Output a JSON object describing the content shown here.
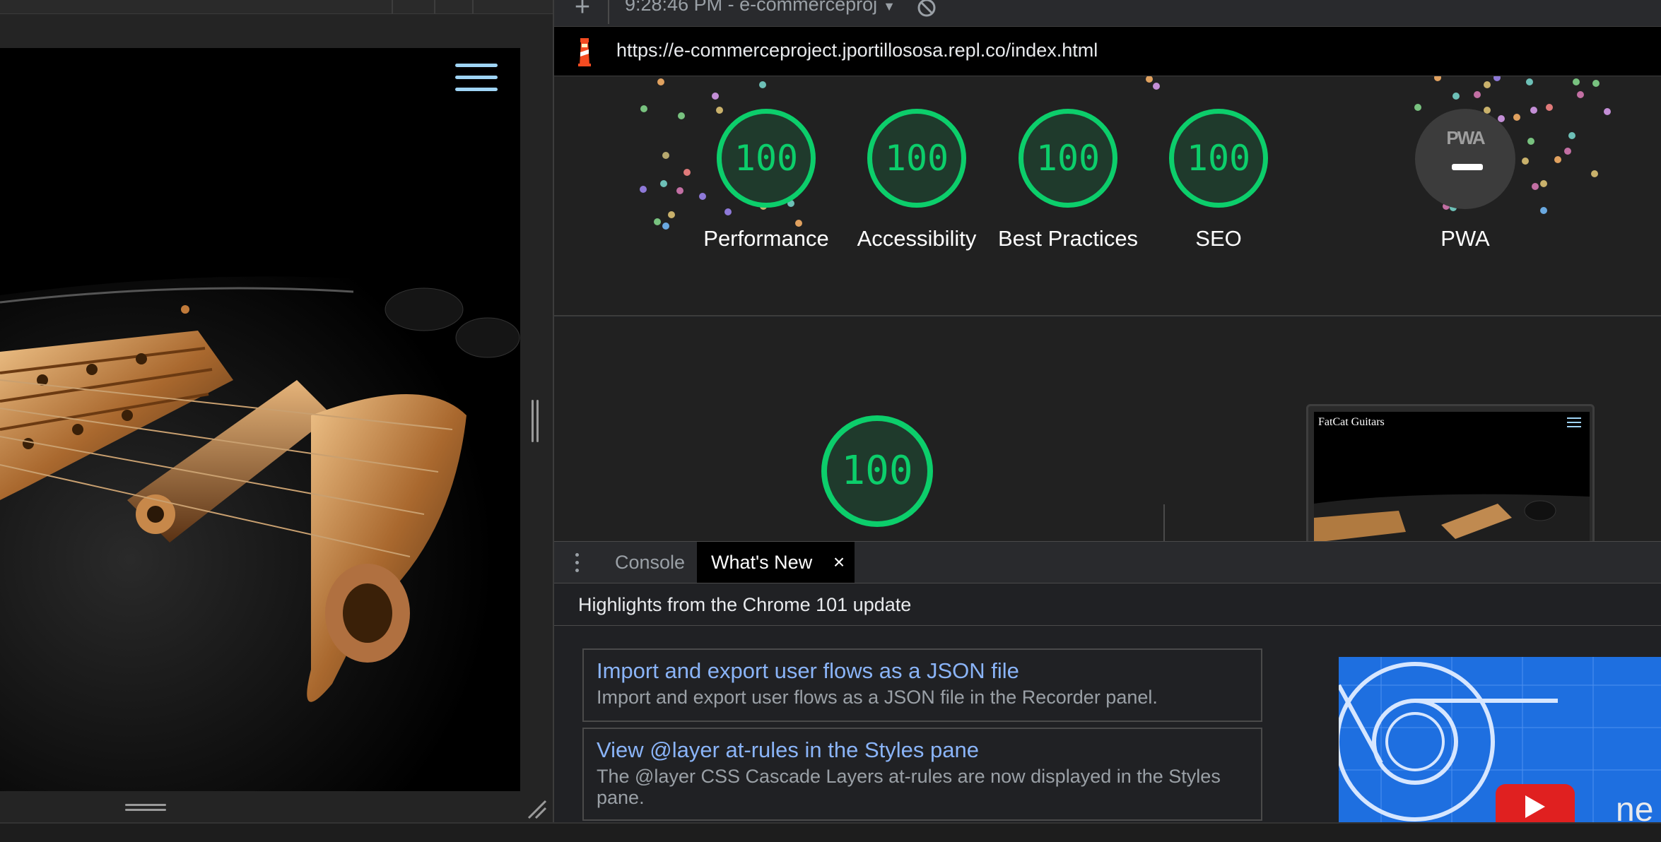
{
  "devtools": {
    "toolbar": {
      "add_label": "+",
      "report_label": "9:28:46 PM - e-commerceproj",
      "report_caret": "▼"
    },
    "url": "https://e-commerceproject.jportillososa.repl.co/index.html",
    "scores": [
      {
        "value": "100",
        "label": "Performance"
      },
      {
        "value": "100",
        "label": "Accessibility"
      },
      {
        "value": "100",
        "label": "Best Practices"
      },
      {
        "value": "100",
        "label": "SEO"
      }
    ],
    "pwa": {
      "badge_text": "PWA",
      "label": "PWA"
    },
    "performance_score": "100",
    "thumbnail": {
      "site_title": "FatCat Guitars"
    },
    "drawer": {
      "tabs": [
        {
          "label": "Console",
          "active": false
        },
        {
          "label": "What's New",
          "active": true,
          "close": "×"
        }
      ],
      "highlights": "Highlights from the Chrome 101 update",
      "features": [
        {
          "title": "Import and export user flows as a JSON file",
          "description": "Import and export user flows as a JSON file in the Recorder panel."
        },
        {
          "title": "View @layer at-rules in the Styles pane",
          "description": "The @layer CSS Cascade Layers at-rules are now displayed in the Styles pane."
        }
      ],
      "video_text": "ne"
    }
  },
  "colors": {
    "pass_green": "#0cce6b",
    "link_blue": "#8ab4f8",
    "hamburger_blue": "#9fd4f5",
    "devtools_bg": "#202124"
  },
  "icons": [
    "lighthouse-icon",
    "clear-icon",
    "hamburger-menu-icon",
    "kebab-menu-icon",
    "youtube-play-icon"
  ]
}
